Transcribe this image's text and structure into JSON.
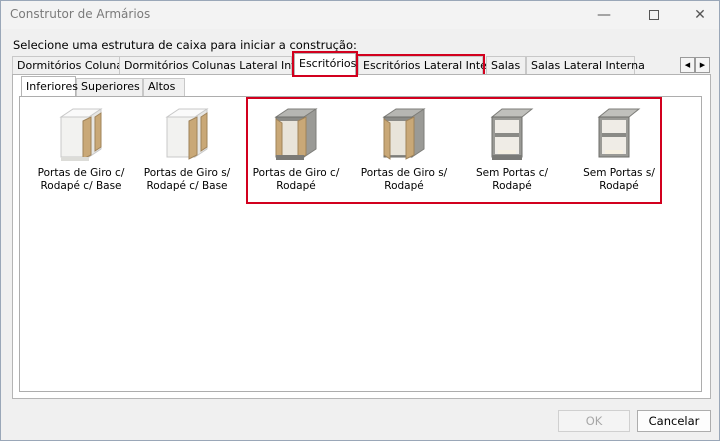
{
  "window": {
    "title": "Construtor de Armários",
    "minimize_glyph": "—",
    "close_glyph": "✕"
  },
  "prompt": "Selecione uma estrutura de caixa para iniciar a construção:",
  "top_tabs": [
    {
      "label": "Dormitórios Colunas"
    },
    {
      "label": "Dormitórios Colunas Lateral Interna"
    },
    {
      "label": "Escritórios"
    },
    {
      "label": "Escritórios Lateral Interna"
    },
    {
      "label": "Salas"
    },
    {
      "label": "Salas Lateral Interna"
    }
  ],
  "scroll_left": "◀",
  "scroll_right": "▶",
  "sub_tabs": [
    {
      "label": "Inferiores"
    },
    {
      "label": "Superiores"
    },
    {
      "label": "Altos"
    }
  ],
  "items": [
    {
      "line1": "Portas de Giro c/",
      "line2": "Rodapé c/ Base"
    },
    {
      "line1": "Portas de Giro s/",
      "line2": "Rodapé c/ Base"
    },
    {
      "line1": "Portas de Giro c/",
      "line2": "Rodapé"
    },
    {
      "line1": "Portas de Giro s/",
      "line2": "Rodapé"
    },
    {
      "line1": "Sem Portas c/",
      "line2": "Rodapé"
    },
    {
      "line1": "Sem Portas s/",
      "line2": "Rodapé"
    }
  ],
  "buttons": {
    "ok": "OK",
    "cancel": "Cancelar"
  },
  "colors": {
    "highlight": "#d2001e",
    "wood": "#c9a877",
    "cabinet_white": "#f4f4f2",
    "cabinet_gray": "#8a8a86"
  }
}
